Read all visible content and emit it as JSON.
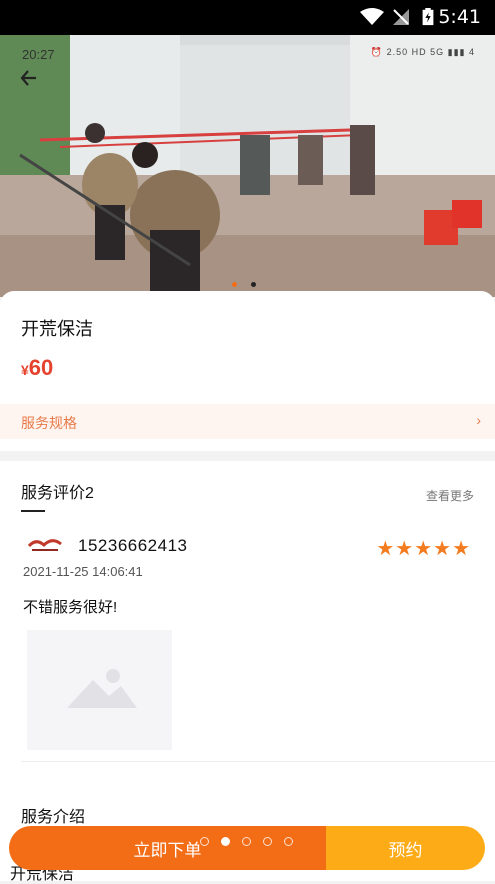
{
  "status_bar": {
    "time": "5:41"
  },
  "hero": {
    "time": "20:27",
    "indicators": "⏰ 2.50 HD 5G ▮▮▮ 4",
    "carousel_dots": 2,
    "carousel_active": 0
  },
  "product": {
    "title": "开荒保洁",
    "currency": "¥",
    "price": "60",
    "spec_label": "服务规格",
    "spec_arrow": "›"
  },
  "reviews": {
    "title": "服务评价2",
    "more": "查看更多",
    "items": [
      {
        "phone": "15236662413",
        "stars": "★★★★★",
        "rating": 5,
        "date": "2021-11-25 14:06:41",
        "comment": "不错服务很好!"
      }
    ]
  },
  "intro": {
    "title": "服务介绍",
    "peek": "开荒保洁"
  },
  "bottom_bar": {
    "order_label": "立即下单",
    "book_label": "预约"
  },
  "colors": {
    "accent": "#f36c16",
    "book": "#fdab17",
    "price": "#e5432e"
  }
}
